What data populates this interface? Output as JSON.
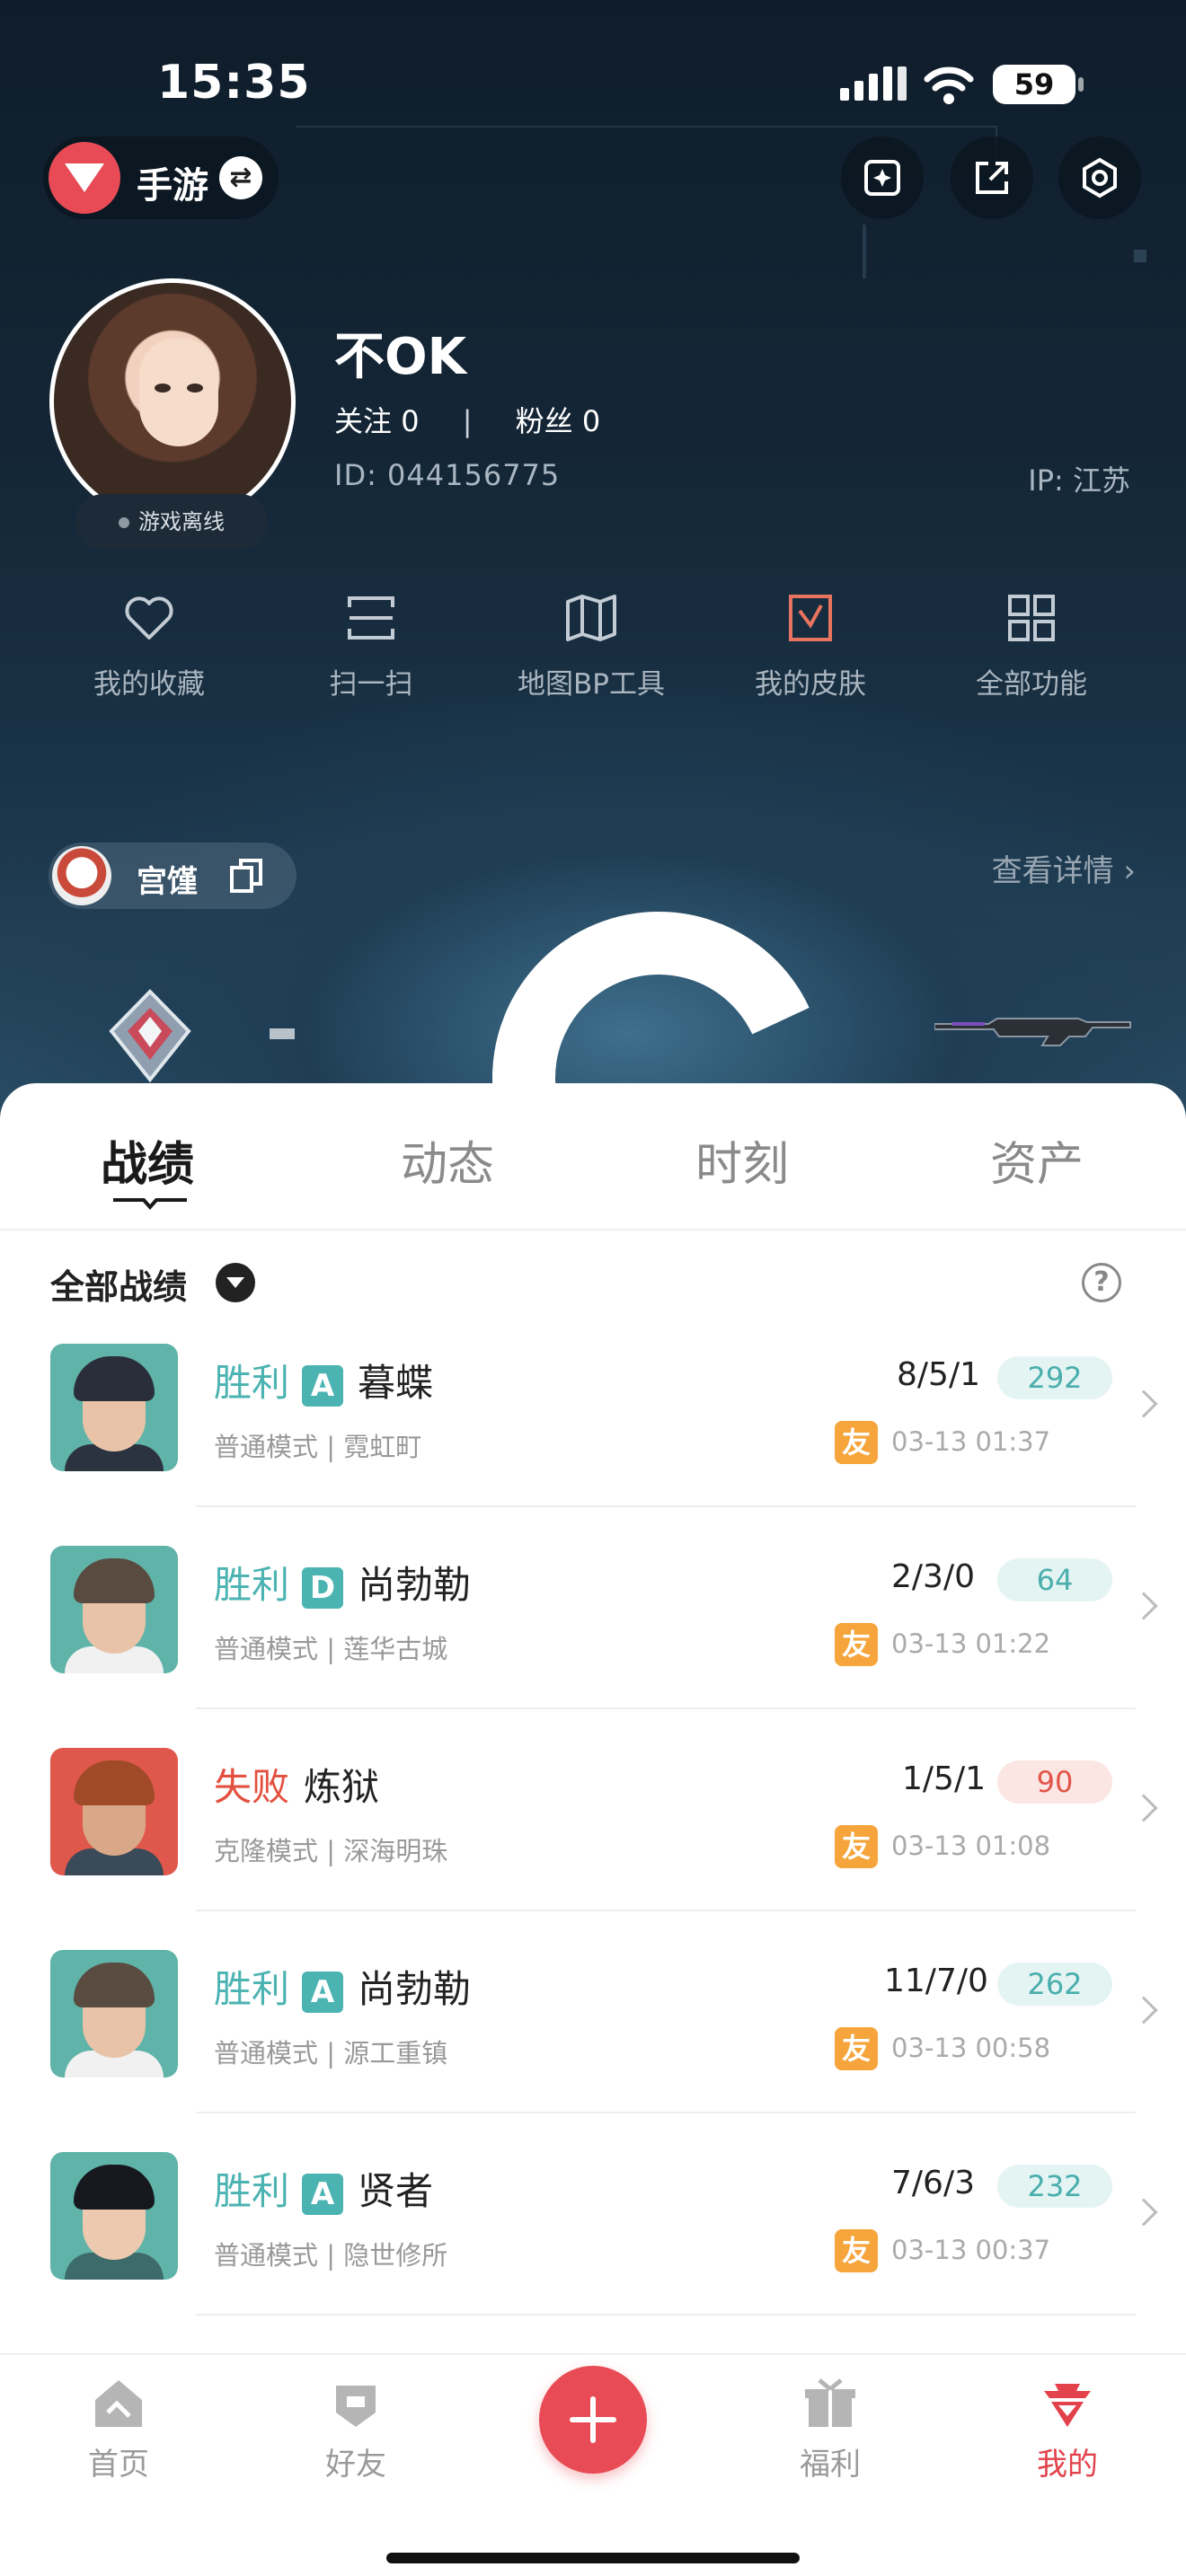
{
  "status_bar": {
    "time": "15:35",
    "battery": "59"
  },
  "header": {
    "game_label": "手游"
  },
  "profile": {
    "username": "不OK",
    "follow_label": "关注",
    "follow_count": "0",
    "fans_label": "粉丝",
    "fans_count": "0",
    "id_text": "ID: 044156775",
    "ip_text": "IP: 江苏",
    "online_status": "游戏离线"
  },
  "functions": [
    {
      "label": "我的收藏",
      "icon": "heart-icon"
    },
    {
      "label": "扫一扫",
      "icon": "scan-icon"
    },
    {
      "label": "地图BP工具",
      "icon": "map-icon"
    },
    {
      "label": "我的皮肤",
      "icon": "skin-icon"
    },
    {
      "label": "全部功能",
      "icon": "grid-icon"
    }
  ],
  "team": {
    "name": "宫馑"
  },
  "detail_link": "查看详情",
  "tabs": [
    "战绩",
    "动态",
    "时刻",
    "资产"
  ],
  "filter": {
    "label": "全部战绩"
  },
  "colors": {
    "win": "#4bb3b1",
    "lose": "#e3503f",
    "accent": "#e84b55",
    "friend": "#f5a53b"
  },
  "matches": [
    {
      "result": "胜利",
      "grade": "A",
      "agent": "暮蝶",
      "mode": "普通模式 | 霓虹町",
      "kda": "8/5/1",
      "score": "292",
      "friend": "友",
      "time": "03-13 01:37"
    },
    {
      "result": "胜利",
      "grade": "D",
      "agent": "尚勃勒",
      "mode": "普通模式 | 莲华古城",
      "kda": "2/3/0",
      "score": "64",
      "friend": "友",
      "time": "03-13 01:22"
    },
    {
      "result": "失败",
      "grade": "",
      "agent": "炼狱",
      "mode": "克隆模式 | 深海明珠",
      "kda": "1/5/1",
      "score": "90",
      "friend": "友",
      "time": "03-13 01:08"
    },
    {
      "result": "胜利",
      "grade": "A",
      "agent": "尚勃勒",
      "mode": "普通模式 | 源工重镇",
      "kda": "11/7/0",
      "score": "262",
      "friend": "友",
      "time": "03-13 00:58"
    },
    {
      "result": "胜利",
      "grade": "A",
      "agent": "贤者",
      "mode": "普通模式 | 隐世修所",
      "kda": "7/6/3",
      "score": "232",
      "friend": "友",
      "time": "03-13 00:37"
    }
  ],
  "nav": [
    {
      "label": "首页",
      "icon": "home-icon"
    },
    {
      "label": "好友",
      "icon": "friends-icon"
    },
    {
      "label": "",
      "icon": "plus-icon"
    },
    {
      "label": "福利",
      "icon": "gift-icon"
    },
    {
      "label": "我的",
      "icon": "profile-icon"
    }
  ]
}
